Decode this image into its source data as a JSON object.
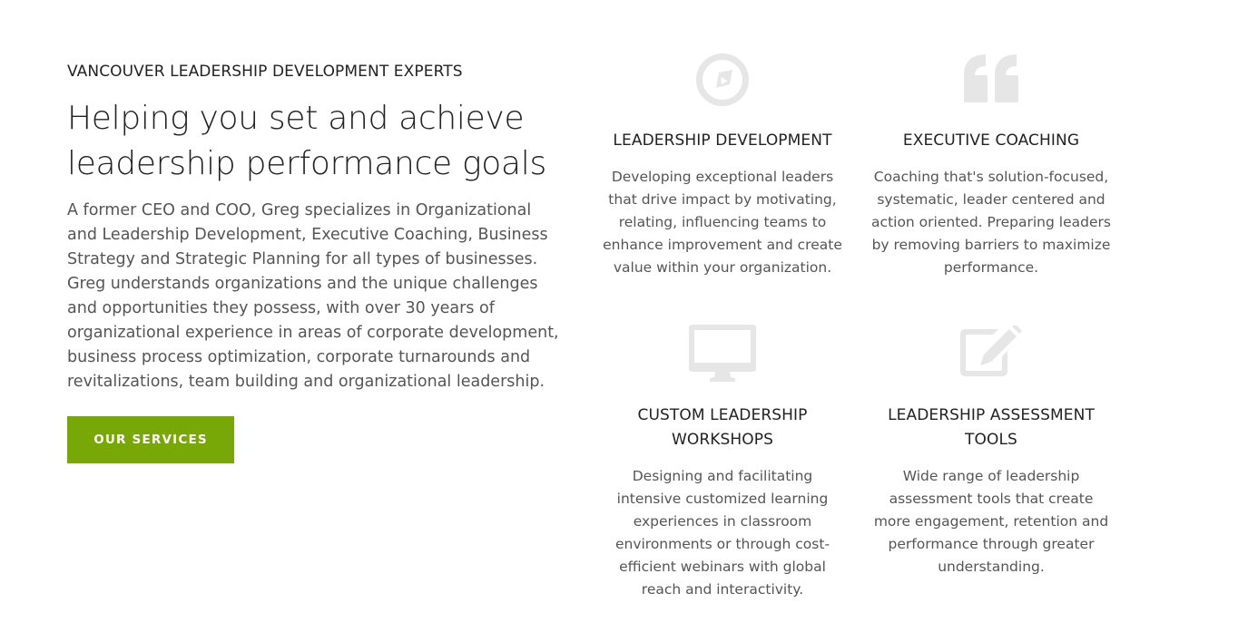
{
  "intro_section": {
    "eyebrow": "VANCOUVER LEADERSHIP DEVELOPMENT EXPERTS",
    "headline_line1": "Helping you set and achieve",
    "headline_line2": "leadership performance goals",
    "body": "A former CEO and COO, Greg specializes in Organizational and Leadership Development, Executive Coaching, Business Strategy and Strategic Planning for all types of businesses. Greg understands organizations and the unique challenges and opportunities they possess, with over 30 years of organizational experience in areas of corporate development, business process optimization, corporate turnarounds and revitalizations, team building and organizational leadership.",
    "cta_label": "OUR SERVICES"
  },
  "services": [
    {
      "icon": "compass-icon",
      "title": "LEADERSHIP DEVELOPMENT",
      "description": "Developing exceptional leaders that drive impact by motivating, relating, influencing teams to enhance improvement and create value within your organization."
    },
    {
      "icon": "quote-icon",
      "title": "EXECUTIVE COACHING",
      "description": "Coaching that's solution-focused, systematic, leader centered and action oriented. Preparing leaders by removing barriers to maximize performance."
    },
    {
      "icon": "monitor-icon",
      "title": "CUSTOM LEADERSHIP WORKSHOPS",
      "description": "Designing and facilitating intensive customized learning experiences in classroom environments or through cost-efficient webinars with global reach and interactivity."
    },
    {
      "icon": "edit-icon",
      "title": "LEADERSHIP ASSESSMENT TOOLS",
      "description": "Wide range of leadership assessment tools that create more engagement, retention and performance through greater understanding."
    }
  ],
  "colors": {
    "accent": "#78a807",
    "icon_gray": "#e6e6e6",
    "text_dark": "#222222",
    "text_body": "#555555"
  }
}
